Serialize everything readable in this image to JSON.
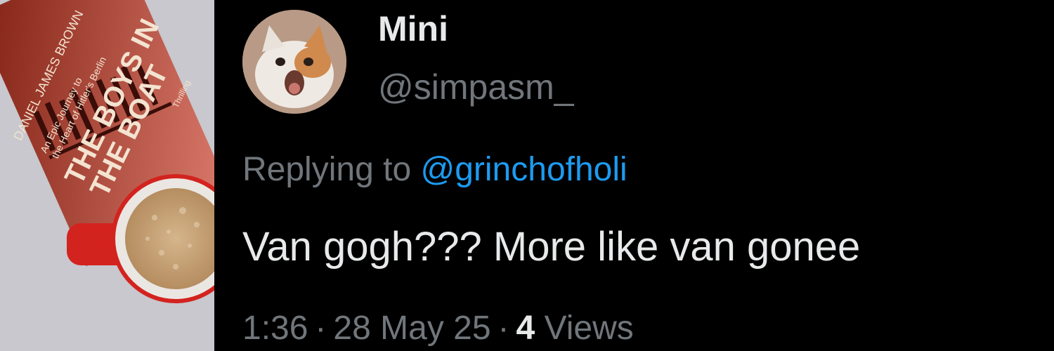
{
  "photo": {
    "book": {
      "title_line1": "THE BOYS IN",
      "title_line2": "THE BOAT",
      "subtitle_line1": "An Epic Journey to",
      "subtitle_line2": "the Heart of Hitler's Berlin",
      "author": "DANIEL JAMES BROWN",
      "tagline": "Thrilling",
      "tagline2": "Inspiring"
    },
    "colors": {
      "book_red": "#c8341e",
      "mug_red": "#d3231f",
      "coffee": "#c9a57c",
      "table": "#c9c9cf"
    }
  },
  "tweet": {
    "author": {
      "display_name": "Mini",
      "handle": "@simpasm_"
    },
    "reply": {
      "prefix": "Replying to ",
      "handle": "@grinchofholi"
    },
    "text": "Van gogh??? More like van gonee",
    "meta": {
      "time": "1:36",
      "date": "28 May 25",
      "views_count": "4",
      "views_label": "Views",
      "separator": "·"
    },
    "colors": {
      "text": "#e7e9ea",
      "muted": "#71767b",
      "link": "#1d9bf0",
      "background": "#000000"
    }
  }
}
